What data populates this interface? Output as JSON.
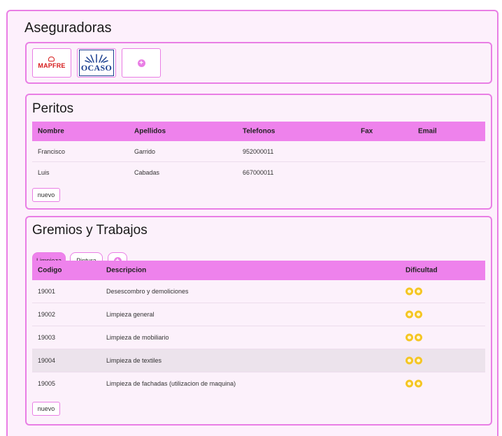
{
  "page": {
    "title": "Aseguradoras"
  },
  "insurers": {
    "logos": [
      {
        "name": "MAPFRE",
        "color": "#d61d1d"
      },
      {
        "name": "OCASO",
        "color": "#1b3f8f"
      }
    ],
    "add_icon": "plus-circle-icon"
  },
  "experts": {
    "title": "Peritos",
    "columns": [
      "Nombre",
      "Apellidos",
      "Telefonos",
      "Fax",
      "Email"
    ],
    "rows": [
      {
        "nombre": "Francisco",
        "apellidos": "Garrido",
        "telefonos": "952000011",
        "fax": "",
        "email": ""
      },
      {
        "nombre": "Luis",
        "apellidos": "Cabadas",
        "telefonos": "667000011",
        "fax": "",
        "email": ""
      }
    ],
    "new_button": "nuevo"
  },
  "trades": {
    "title": "Gremios y Trabajos",
    "tabs": [
      "Limpieza",
      "Pintura"
    ],
    "active_tab": "Limpieza",
    "columns": [
      "Codigo",
      "Descripcion",
      "Dificultad"
    ],
    "rows": [
      {
        "codigo": "19001",
        "descripcion": "Desescombro y demoliciones",
        "dificultad": 2
      },
      {
        "codigo": "19002",
        "descripcion": "Limpieza general",
        "dificultad": 2
      },
      {
        "codigo": "19003",
        "descripcion": "Limpieza de mobiliario",
        "dificultad": 2
      },
      {
        "codigo": "19004",
        "descripcion": "Limpieza de textiles",
        "dificultad": 2
      },
      {
        "codigo": "19005",
        "descripcion": "Limpieza de fachadas (utilizacion de maquina)",
        "dificultad": 2
      }
    ],
    "highlighted_row": "19004",
    "new_button": "nuevo"
  },
  "colors": {
    "accent": "#ee82ec",
    "border": "#e97ee5",
    "panel_bg": "#fcf1fb",
    "star": "#f5c623"
  }
}
